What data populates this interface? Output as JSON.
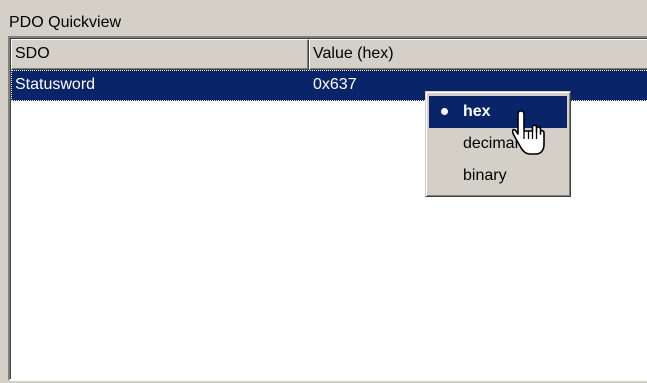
{
  "panel": {
    "title": "PDO Quickview"
  },
  "table": {
    "columns": [
      "SDO",
      "Value (hex)"
    ],
    "rows": [
      {
        "sdo": "Statusword",
        "value": "0x637"
      }
    ]
  },
  "context_menu": {
    "items": [
      {
        "label": "hex",
        "checked": true
      },
      {
        "label": "decimal",
        "checked": false
      },
      {
        "label": "binary",
        "checked": false
      }
    ]
  },
  "colors": {
    "selection": "#0a246a",
    "face": "#d4d0c8"
  },
  "icons": {
    "cursor": "hand-pointer-icon",
    "bullet": "radio-bullet-icon"
  }
}
